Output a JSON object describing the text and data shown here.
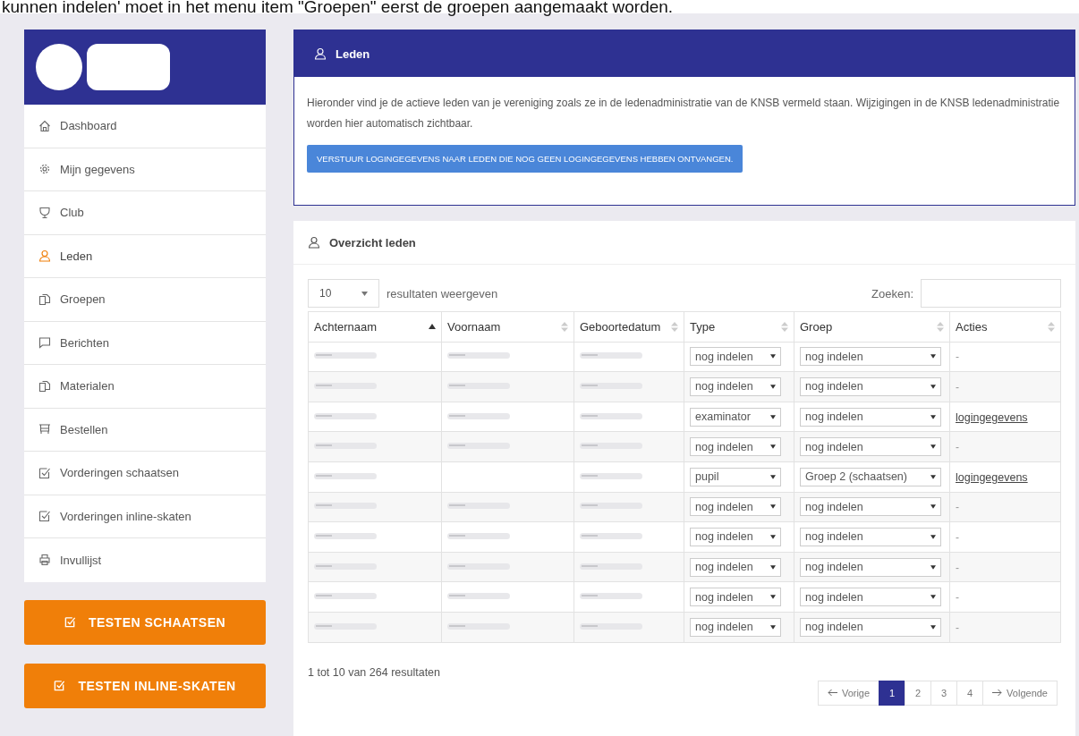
{
  "caption": "kunnen indelen' moet in het menu item \"Groepen\" eerst de groepen aangemaakt worden.",
  "sidebar": {
    "items": [
      {
        "label": "Dashboard",
        "selected": false
      },
      {
        "label": "Mijn gegevens",
        "selected": false
      },
      {
        "label": "Club",
        "selected": false
      },
      {
        "label": "Leden",
        "selected": true
      },
      {
        "label": "Groepen",
        "selected": false
      },
      {
        "label": "Berichten",
        "selected": false
      },
      {
        "label": "Materialen",
        "selected": false
      },
      {
        "label": "Bestellen",
        "selected": false
      },
      {
        "label": "Vorderingen schaatsen",
        "selected": false
      },
      {
        "label": "Vorderingen inline-skaten",
        "selected": false
      },
      {
        "label": "Invullijst",
        "selected": false
      }
    ],
    "buttons": [
      "TESTEN SCHAATSEN",
      "TESTEN INLINE-SKATEN"
    ]
  },
  "info_card": {
    "title": "Leden",
    "text": "Hieronder vind je de actieve leden van je vereniging zoals ze in de ledenadministratie van de KNSB vermeld staan. Wijzigingen in de KNSB ledenadministratie worden hier automatisch zichtbaar.",
    "button": "VERSTUUR LOGINGEGEVENS NAAR LEDEN DIE NOG GEEN LOGINGEGEVENS HEBBEN ONTVANGEN."
  },
  "table_card": {
    "title": "Overzicht leden",
    "page_size": "10",
    "page_size_label": "resultaten weergeven",
    "search_label": "Zoeken:",
    "columns": [
      {
        "label": "Achternaam",
        "sorted": true
      },
      {
        "label": "Voornaam",
        "sorted": false
      },
      {
        "label": "Geboortedatum",
        "sorted": false
      },
      {
        "label": "Type",
        "sorted": false
      },
      {
        "label": "Groep",
        "sorted": false
      },
      {
        "label": "Acties",
        "sorted": false
      }
    ],
    "rows": [
      {
        "redacted": [
          true,
          true,
          true
        ],
        "type": "nog indelen",
        "group": "nog indelen",
        "action": {
          "kind": "text",
          "text": "-"
        }
      },
      {
        "redacted": [
          true,
          true,
          true
        ],
        "type": "nog indelen",
        "group": "nog indelen",
        "action": {
          "kind": "text",
          "text": "-"
        }
      },
      {
        "redacted": [
          true,
          true,
          true
        ],
        "type": "examinator",
        "group": "nog indelen",
        "action": {
          "kind": "link",
          "text": "logingegevens"
        }
      },
      {
        "redacted": [
          true,
          true,
          true
        ],
        "type": "nog indelen",
        "group": "nog indelen",
        "action": {
          "kind": "text",
          "text": "-"
        }
      },
      {
        "redacted": [
          true,
          false,
          true
        ],
        "type": "pupil",
        "group": "Groep 2 (schaatsen)",
        "action": {
          "kind": "link",
          "text": "logingegevens"
        }
      },
      {
        "redacted": [
          true,
          true,
          true
        ],
        "type": "nog indelen",
        "group": "nog indelen",
        "action": {
          "kind": "text",
          "text": "-"
        }
      },
      {
        "redacted": [
          true,
          true,
          true
        ],
        "type": "nog indelen",
        "group": "nog indelen",
        "action": {
          "kind": "text",
          "text": "-"
        }
      },
      {
        "redacted": [
          true,
          true,
          true
        ],
        "type": "nog indelen",
        "group": "nog indelen",
        "action": {
          "kind": "text",
          "text": "-"
        }
      },
      {
        "redacted": [
          true,
          true,
          true
        ],
        "type": "nog indelen",
        "group": "nog indelen",
        "action": {
          "kind": "text",
          "text": "-"
        }
      },
      {
        "redacted": [
          true,
          true,
          true
        ],
        "type": "nog indelen",
        "group": "nog indelen",
        "action": {
          "kind": "text",
          "text": "-"
        }
      }
    ],
    "summary": "1 tot 10 van 264 resultaten",
    "pagination": {
      "previous": "Vorige",
      "next": "Volgende",
      "pages": [
        {
          "label": "1",
          "selected": true
        },
        {
          "label": "2",
          "selected": false
        },
        {
          "label": "3",
          "selected": false
        },
        {
          "label": "4",
          "selected": false
        }
      ]
    }
  }
}
